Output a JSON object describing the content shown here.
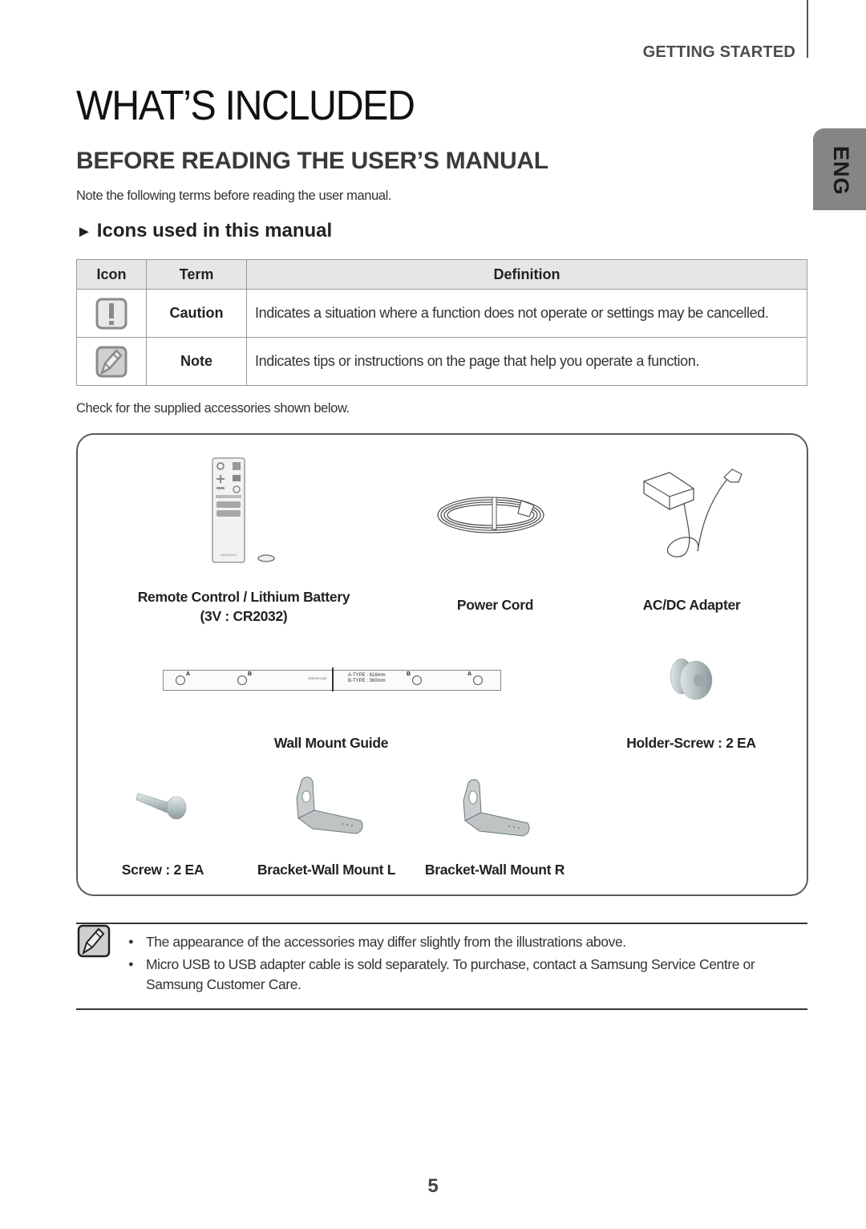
{
  "header": {
    "section": "GETTING STARTED",
    "language_tab": "ENG"
  },
  "page": {
    "title": "WHAT’S INCLUDED",
    "subtitle": "BEFORE READING THE USER’S MANUAL",
    "intro": "Note the following terms before reading the user manual.",
    "icons_heading": "Icons used in this manual",
    "icons_heading_marker": "►"
  },
  "icons_table": {
    "headers": [
      "Icon",
      "Term",
      "Definition"
    ],
    "rows": [
      {
        "icon": "caution-icon",
        "term": "Caution",
        "definition": "Indicates a situation where a function does not operate or settings may be cancelled."
      },
      {
        "icon": "note-icon",
        "term": "Note",
        "definition": "Indicates tips or instructions on the page that help you operate a function."
      }
    ]
  },
  "accessories": {
    "intro": "Check for the supplied accessories shown below.",
    "items": [
      {
        "name": "Remote Control / Lithium Battery",
        "sub": "(3V : CR2032)",
        "icon": "remote-control-icon"
      },
      {
        "name": "Power Cord",
        "icon": "power-cord-icon"
      },
      {
        "name": "AC/DC Adapter",
        "icon": "ac-dc-adapter-icon"
      },
      {
        "name": "Wall Mount Guide",
        "icon": "wall-mount-guide-icon"
      },
      {
        "name": "Holder-Screw : 2 EA",
        "icon": "holder-screw-icon"
      },
      {
        "name": "Screw : 2 EA",
        "icon": "screw-icon"
      },
      {
        "name": "Bracket-Wall Mount L",
        "icon": "bracket-left-icon"
      },
      {
        "name": "Bracket-Wall Mount R",
        "icon": "bracket-right-icon"
      }
    ],
    "guide_text": {
      "a": "A",
      "b": "B",
      "center": "CENTER LINE",
      "a_type": "A-TYPE : 616mm",
      "b_type": "B-TYPE : 360mm"
    },
    "remote_brand": "SAMSUNG"
  },
  "notes": [
    "The appearance of the accessories may differ slightly from the illustrations above.",
    "Micro USB to USB adapter cable is sold separately. To purchase, contact a Samsung Service Centre or Samsung Customer Care."
  ],
  "page_number": "5"
}
